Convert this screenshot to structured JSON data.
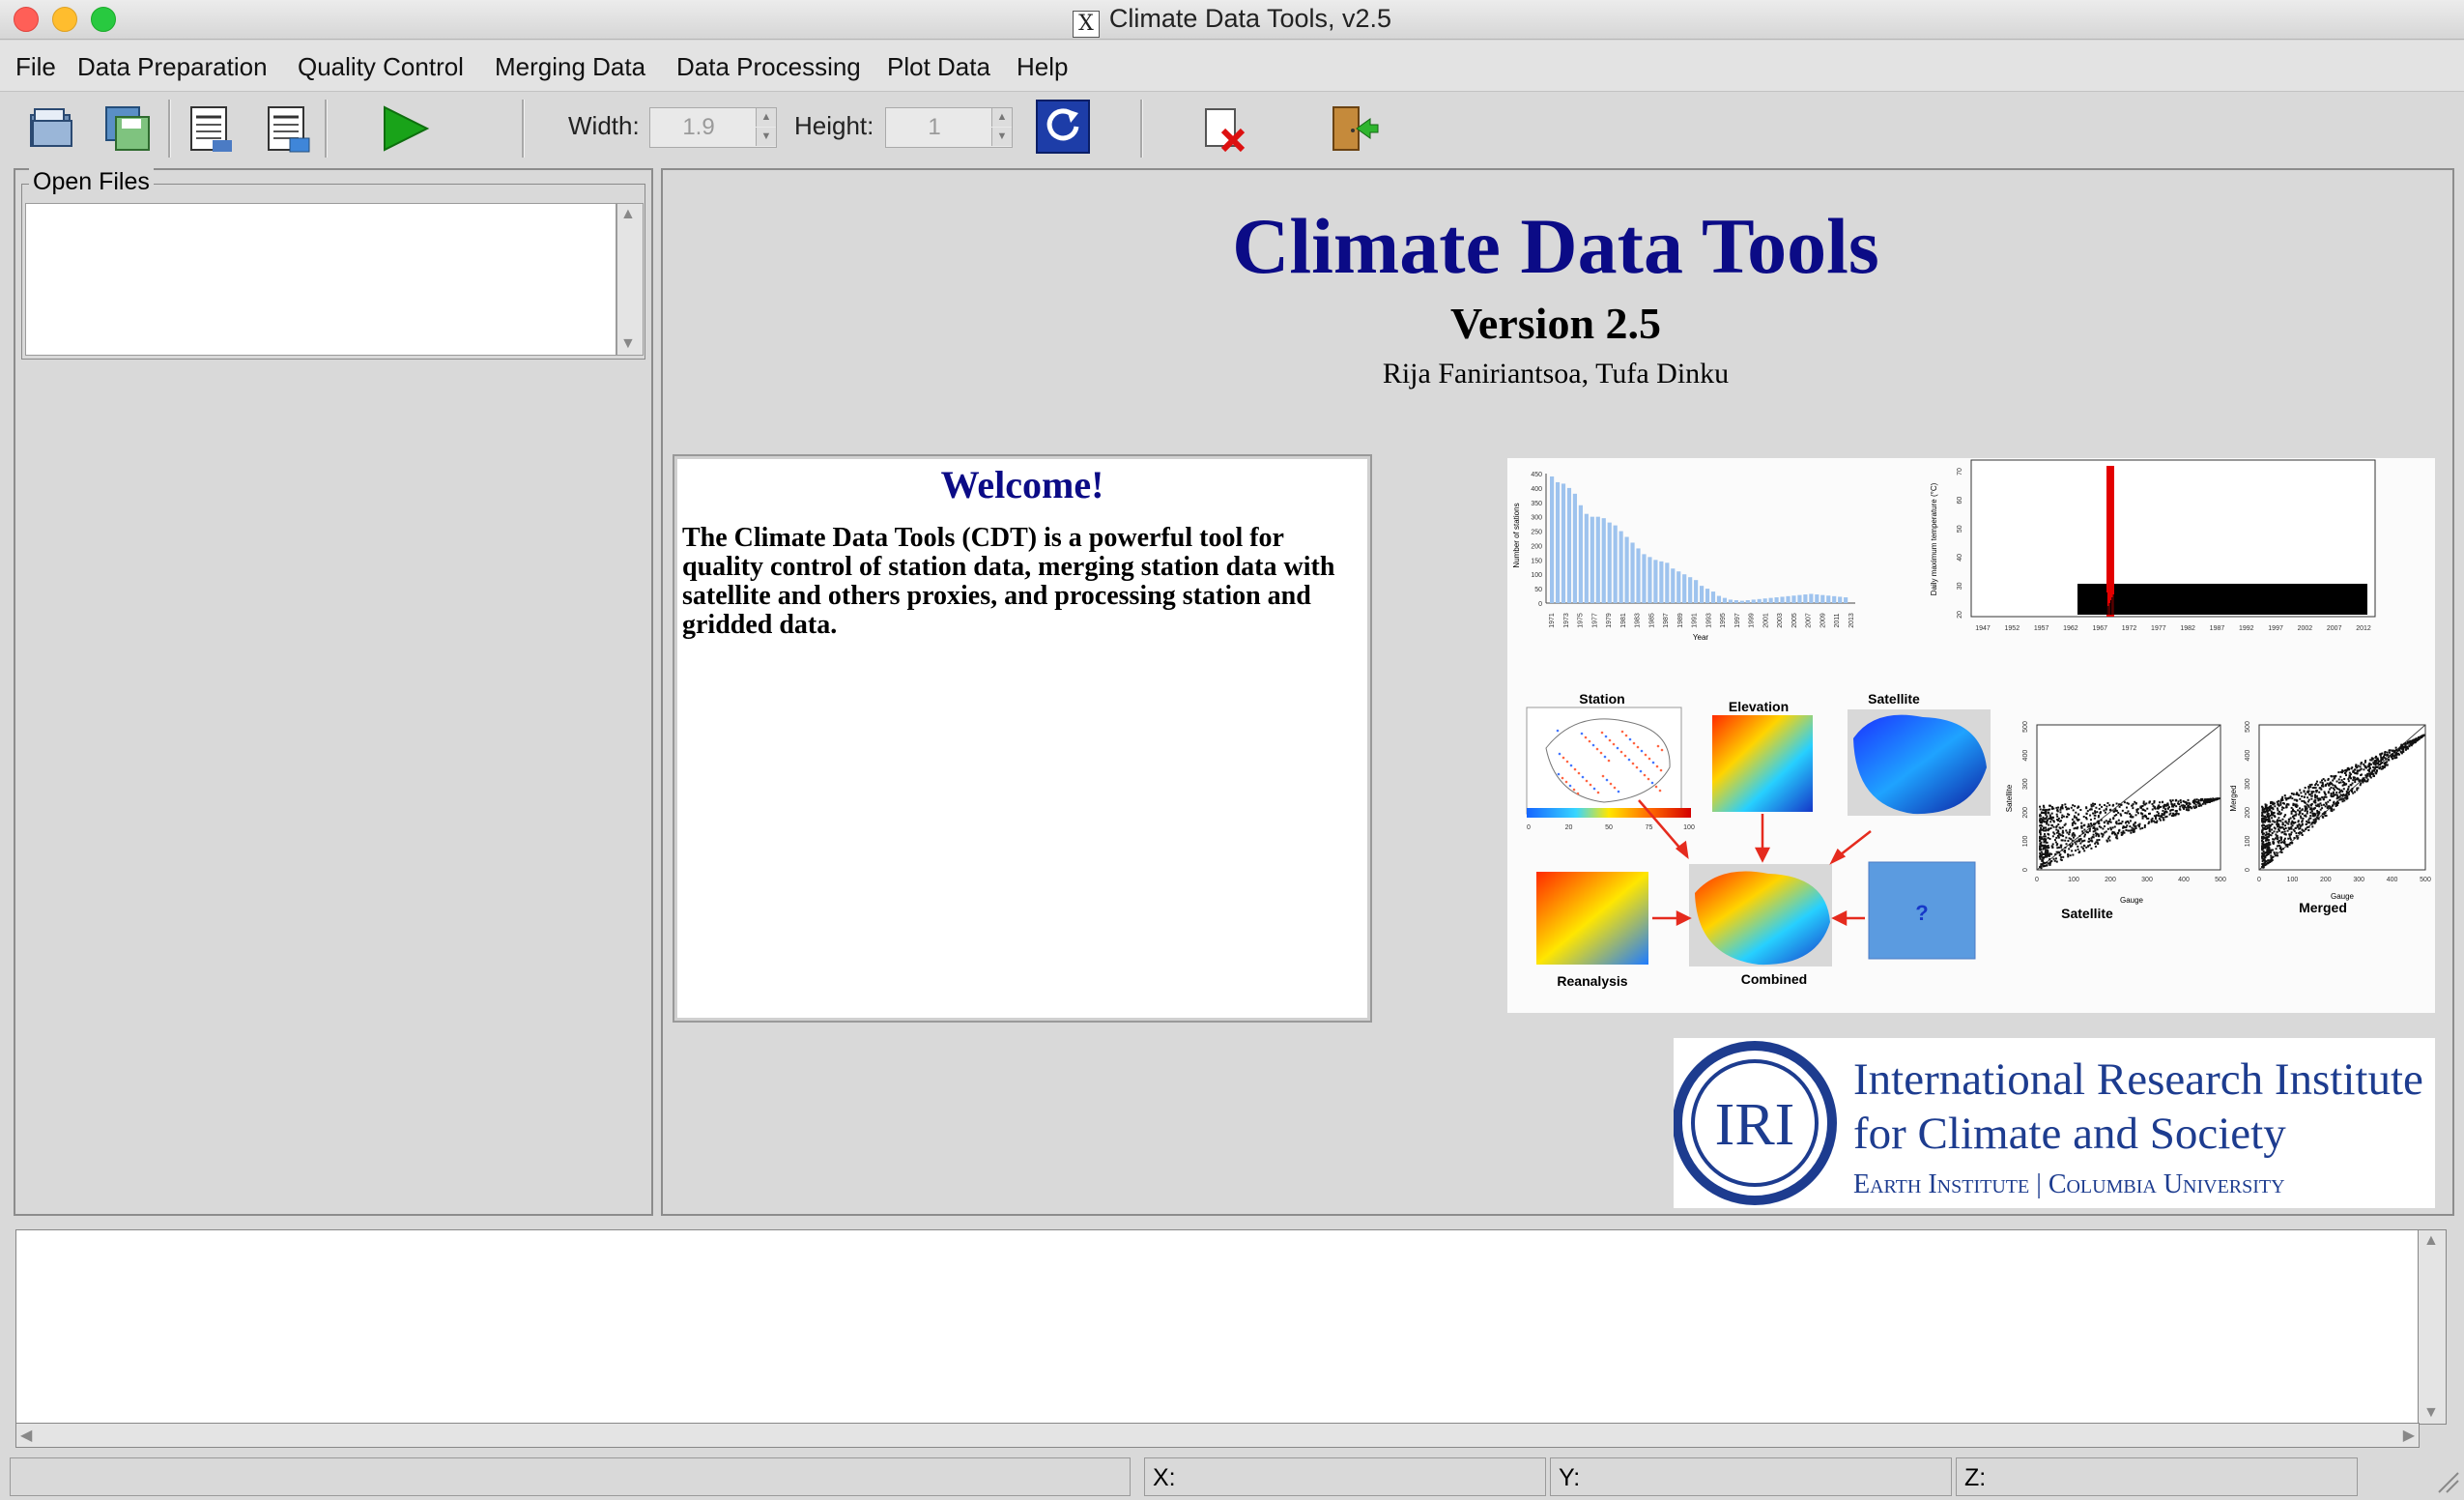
{
  "window": {
    "title": "Climate Data Tools, v2.5"
  },
  "menu": [
    "File",
    "Data Preparation",
    "Quality Control",
    "Merging Data",
    "Data Processing",
    "Plot Data",
    "Help"
  ],
  "toolbar": {
    "width_label": "Width:",
    "width_value": "1.9",
    "height_label": "Height:",
    "height_value": "1"
  },
  "left_panel": {
    "open_files_title": "Open Files"
  },
  "main": {
    "app_title": "Climate Data Tools",
    "version": "Version 2.5",
    "authors": "Rija Faniriantsoa, Tufa Dinku",
    "welcome_title": "Welcome!",
    "welcome_text": "The Climate Data Tools (CDT) is a powerful tool for quality control of station data, merging station data with satellite and others proxies, and processing station and gridded data."
  },
  "figure": {
    "labels": {
      "station": "Station",
      "elevation": "Elevation",
      "satellite": "Satellite",
      "reanalysis": "Reanalysis",
      "combined": "Combined",
      "unknown": "?",
      "scatter1": "Satellite",
      "scatter2": "Merged",
      "year": "Year",
      "gauge": "Gauge",
      "bar_ylabel": "Number of stations",
      "tmax_ylabel": "Daily maximum temperature (°C)"
    },
    "bar_values": [
      440,
      420,
      415,
      400,
      380,
      340,
      310,
      300,
      300,
      295,
      280,
      270,
      250,
      230,
      210,
      190,
      170,
      160,
      150,
      145,
      140,
      120,
      110,
      100,
      90,
      80,
      60,
      50,
      40,
      25,
      18,
      12,
      10,
      8,
      10,
      12,
      14,
      16,
      18,
      20,
      22,
      24,
      26,
      28,
      30,
      32,
      30,
      28,
      26,
      24,
      22,
      20
    ],
    "bar_yticks": [
      "450",
      "400",
      "350",
      "300",
      "250",
      "200",
      "150",
      "100",
      "50",
      "0"
    ],
    "bar_xticks": [
      "1971",
      "1973",
      "1975",
      "1977",
      "1979",
      "1981",
      "1983",
      "1985",
      "1987",
      "1989",
      "1991",
      "1993",
      "1995",
      "1997",
      "1999",
      "2001",
      "2003",
      "2005",
      "2007",
      "2009",
      "2011",
      "2013"
    ],
    "tmax_yticks": [
      "70",
      "60",
      "50",
      "40",
      "30",
      "20"
    ],
    "tmax_xticks": [
      "1947",
      "1952",
      "1957",
      "1962",
      "1967",
      "1972",
      "1977",
      "1982",
      "1987",
      "1992",
      "1997",
      "2002",
      "2007",
      "2012"
    ],
    "map_scale_ticks": [
      "0",
      "20",
      "50",
      "75",
      "100"
    ],
    "sat_scatter_ticks_x": [
      "0",
      "100",
      "200",
      "300",
      "400",
      "500"
    ],
    "sat_scatter_ticks_y": [
      "500",
      "400",
      "300",
      "200",
      "100",
      "0"
    ],
    "sat_scatter_ylabel": "Satellite",
    "merged_scatter_ticks_x": [
      "0",
      "100",
      "200",
      "300",
      "400",
      "500"
    ],
    "merged_scatter_ticks_y": [
      "500",
      "400",
      "300",
      "200",
      "100",
      "0"
    ],
    "merged_scatter_ylabel": "Merged"
  },
  "logo": {
    "mark": "IRI",
    "line1": "International Research Institute",
    "line2": "for Climate and Society",
    "line3": "Earth Institute | Columbia University"
  },
  "status": {
    "x": "X:",
    "y": "Y:",
    "z": "Z:"
  },
  "colors": {
    "title_blue": "#0b0b86",
    "iri_blue": "#1d3c8f",
    "play_green": "#19a319",
    "bar_blue": "#9ec3ee"
  }
}
